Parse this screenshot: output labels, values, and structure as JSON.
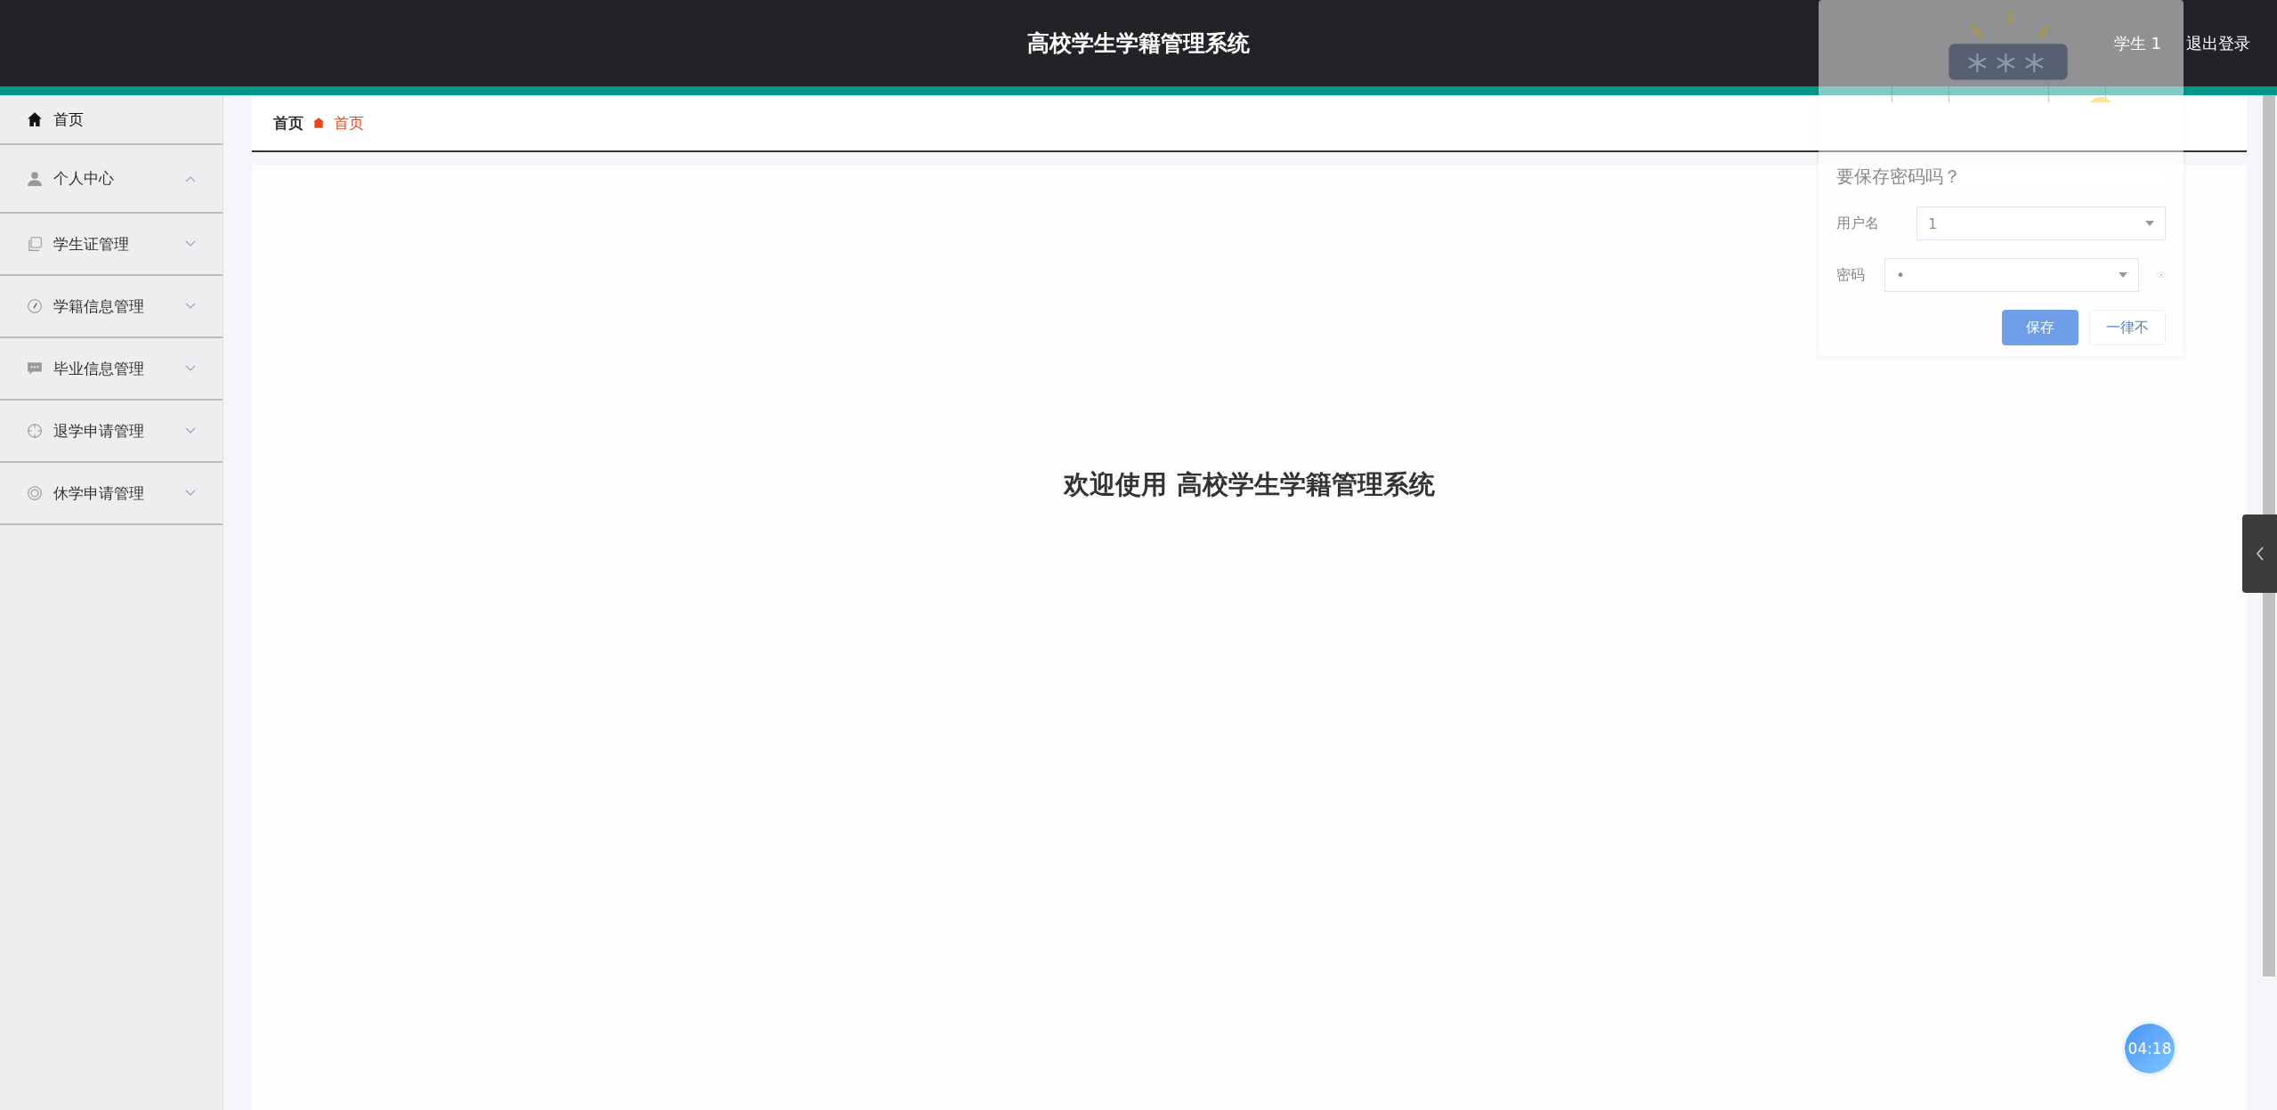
{
  "header": {
    "title": "高校学生学籍管理系统",
    "user": "学生 1",
    "logout": "退出登录"
  },
  "sidebar": {
    "items": [
      {
        "label": "首页",
        "kind": "link"
      },
      {
        "label": "个人中心",
        "kind": "submenu",
        "expanded": true
      },
      {
        "label": "学生证管理",
        "kind": "submenu",
        "expanded": false
      },
      {
        "label": "学籍信息管理",
        "kind": "submenu",
        "expanded": false
      },
      {
        "label": "毕业信息管理",
        "kind": "submenu",
        "expanded": false
      },
      {
        "label": "退学申请管理",
        "kind": "submenu",
        "expanded": false
      },
      {
        "label": "休学申请管理",
        "kind": "submenu",
        "expanded": false
      }
    ]
  },
  "breadcrumb": [
    {
      "label": "首页"
    },
    {
      "label": "首页"
    }
  ],
  "welcome": "欢迎使用 高校学生学籍管理系统",
  "save_password_popup": {
    "title": "要保存密码吗？",
    "username_label": "用户名",
    "username": "1",
    "password_label": "密码",
    "password": "•",
    "save": "保存",
    "never": "一律不"
  },
  "timer": "04:18"
}
